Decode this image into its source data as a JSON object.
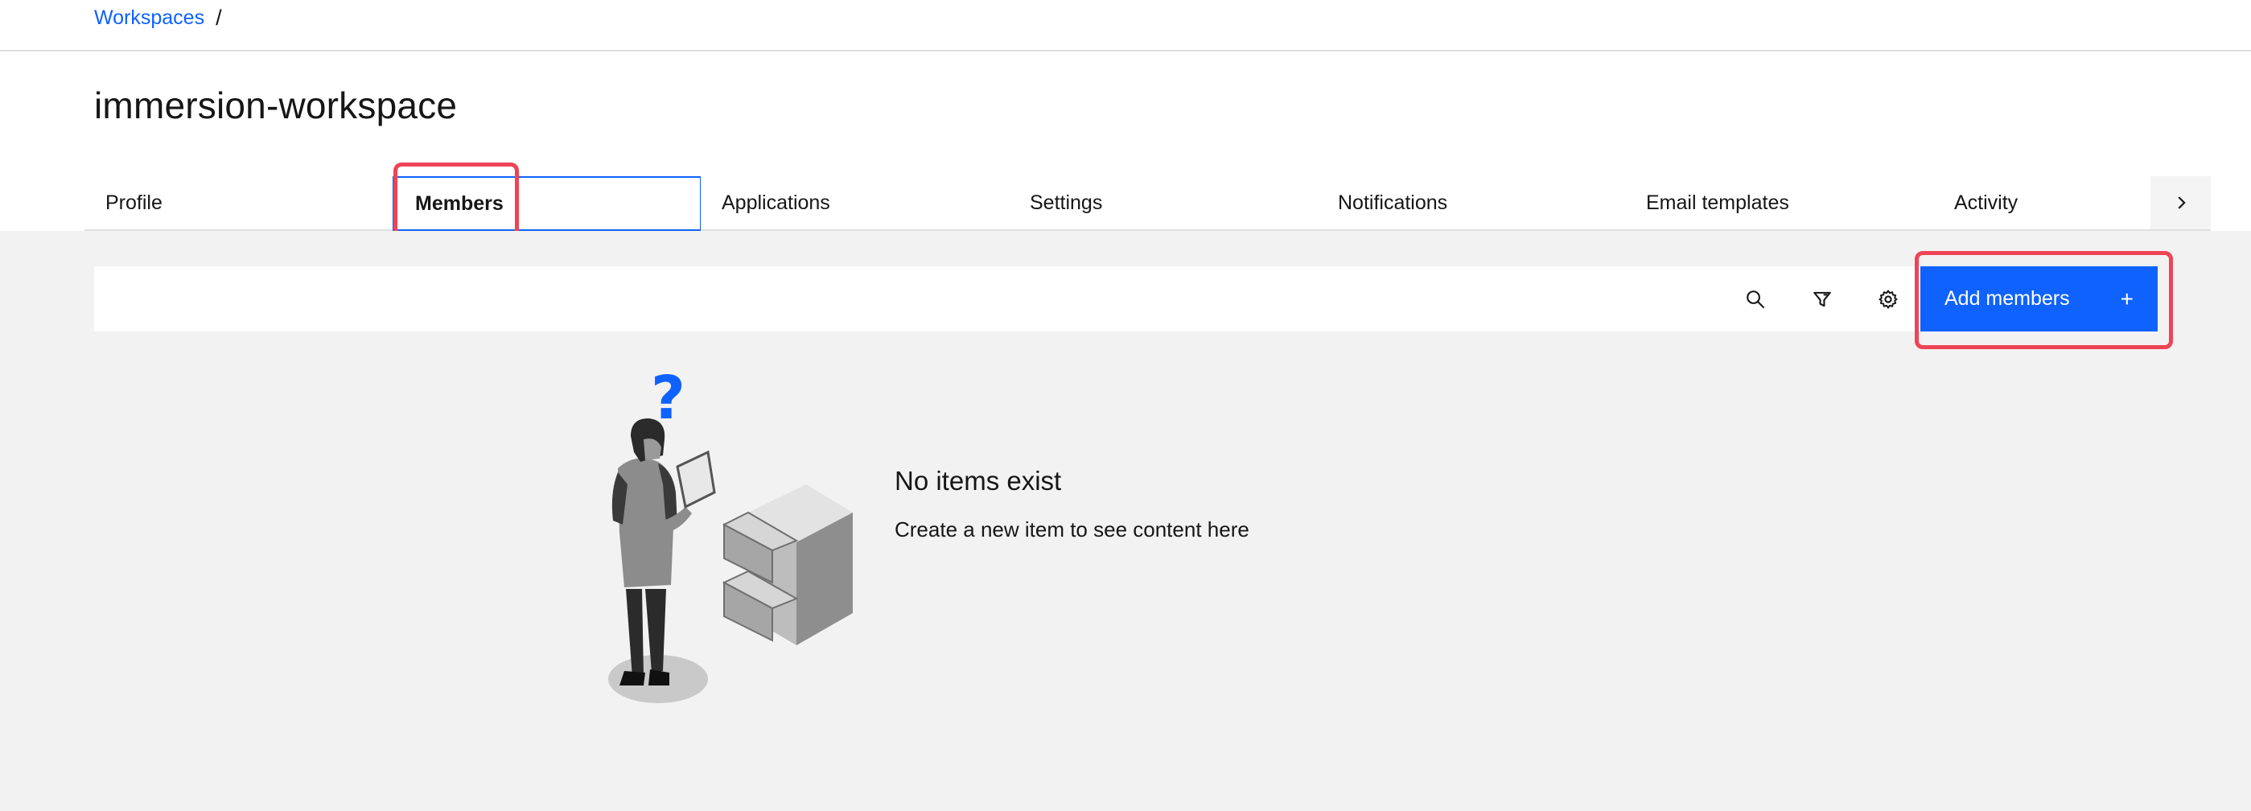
{
  "breadcrumb": {
    "items": [
      {
        "label": "Workspaces"
      }
    ],
    "separator": "/"
  },
  "page": {
    "title": "immersion-workspace"
  },
  "tabs": [
    {
      "label": "Profile",
      "active": false
    },
    {
      "label": "Members",
      "active": true
    },
    {
      "label": "Applications",
      "active": false
    },
    {
      "label": "Settings",
      "active": false
    },
    {
      "label": "Notifications",
      "active": false
    },
    {
      "label": "Email templates",
      "active": false
    },
    {
      "label": "Activity",
      "active": false
    }
  ],
  "toolbar": {
    "icons": [
      "search-icon",
      "filter-icon",
      "settings-icon"
    ],
    "add_label": "Add members",
    "add_icon": "+"
  },
  "empty_state": {
    "title": "No items exist",
    "description": "Create a new item to see content here"
  },
  "colors": {
    "accent": "#0f62fe",
    "highlight": "#ee4455",
    "background": "#f2f2f2"
  }
}
